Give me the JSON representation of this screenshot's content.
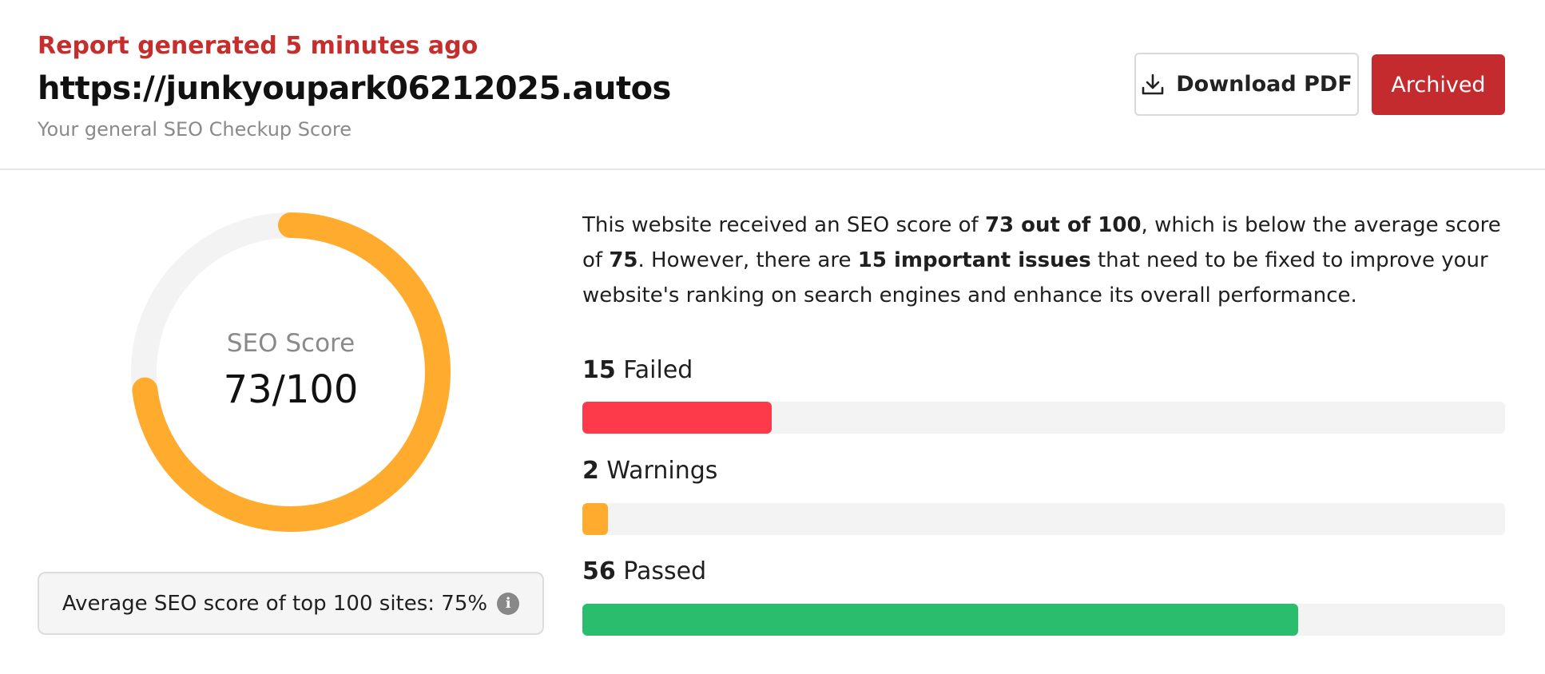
{
  "header": {
    "report_time": "Report generated 5 minutes ago",
    "url": "https://junkyoupark06212025.autos",
    "subtitle": "Your general SEO Checkup Score"
  },
  "actions": {
    "download_label": "Download PDF",
    "archived_label": "Archived"
  },
  "score": {
    "label": "SEO Score",
    "value_text": "73/100",
    "value": 73,
    "max": 100,
    "color": "#ffab2d",
    "track_color": "#f3f3f3"
  },
  "average": {
    "text": "Average SEO score of top 100 sites: 75%",
    "info_icon": "i"
  },
  "description": {
    "p1": "This website received an SEO score of ",
    "b1": "73 out of 100",
    "p2": ", which is below the average score of ",
    "b2": "75",
    "p3": ". However, there are ",
    "b3": "15 important issues",
    "p4": " that need to be fixed to improve your website's ranking on search engines and enhance its overall performance."
  },
  "stats": {
    "failed": {
      "count": "15",
      "label": "Failed",
      "fraction": 0.205,
      "color": "#fd3a4a"
    },
    "warnings": {
      "count": "2",
      "label": "Warnings",
      "fraction": 0.028,
      "color": "#ffab2d"
    },
    "passed": {
      "count": "56",
      "label": "Passed",
      "fraction": 0.776,
      "color": "#2bbd6e"
    }
  },
  "colors": {
    "accent_red": "#c42b2f",
    "report_time": "#c62d2d"
  }
}
